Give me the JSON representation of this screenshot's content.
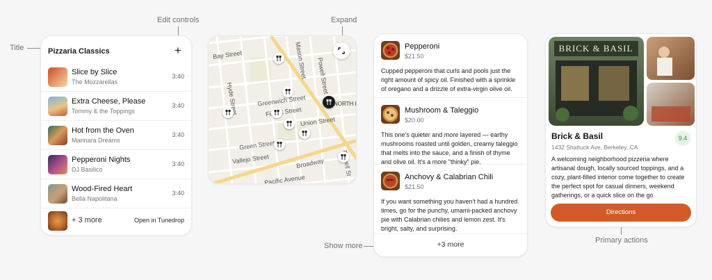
{
  "annotations": {
    "title": "Title",
    "edit_controls": "Edit controls",
    "expand": "Expand",
    "show_more": "Show more",
    "primary_actions": "Primary actions"
  },
  "playlist": {
    "title": "Pizzaria Classics",
    "add_icon": "plus-icon",
    "tracks": [
      {
        "title": "Slice by Slice",
        "artist": "The Mozzarellas",
        "duration": "3:40"
      },
      {
        "title": "Extra Cheese, Please",
        "artist": "Tommy & the Toppings",
        "duration": "3:40"
      },
      {
        "title": "Hot from the Oven",
        "artist": "Marinara Dreams",
        "duration": "3:40"
      },
      {
        "title": "Pepperoni Nights",
        "artist": "DJ Basilico",
        "duration": "3:40"
      },
      {
        "title": "Wood-Fired Heart",
        "artist": "Bella Napolitana",
        "duration": "3:40"
      }
    ],
    "more_label": "+ 3 more",
    "open_label": "Open in Tunedrop"
  },
  "map": {
    "streets": {
      "bay": "Bay Street",
      "mason": "Mason Street",
      "powell_top": "Powell Street",
      "hyde": "Hyde Street",
      "greenwich": "Greenwich Street",
      "filbert": "Filbert Street",
      "union": "Union Street",
      "green": "Green Street",
      "vallejo": "Vallejo Street",
      "broadway": "Broadway",
      "pacific": "Pacific Avenue",
      "powell_bottom": "Powell St",
      "north_beach": "NORTH BE"
    },
    "expand_icon": "expand-icon",
    "pin_icon": "restaurant-icon"
  },
  "menu": {
    "items": [
      {
        "name": "Pepperoni",
        "price": "$21.50",
        "description": "Cupped pepperoni that curls and pools just the right amount of spicy oil. Finished with a sprinkle of oregano and a drizzle of extra-virgin olive oil."
      },
      {
        "name": "Mushroom & Taleggio",
        "price": "$20.00",
        "description": "This one's quieter and more layered — earthy mushrooms roasted until golden, creamy taleggio that melts into the sauce, and a finish of thyme and olive oil. It's a more \"thinky\" pie."
      },
      {
        "name": "Anchovy & Calabrian Chili",
        "price": "$21.50",
        "description": "If you want something you haven't had a hundred times, go for the punchy, umami-packed anchovy pie with Calabrian chilies and lemon zest. It's bright, salty, and surprising."
      }
    ],
    "show_more_label": "+3 more"
  },
  "venue": {
    "sign_text": "BRICK & BASIL",
    "name": "Brick & Basil",
    "address": "1432 Shattuck Ave, Berkeley, CA",
    "rating": "9.4",
    "description": "A welcoming neighborhood pizzeria where artisanal dough, locally sourced toppings, and a cozy, plant-filled interior come together to create the perfect spot for casual dinners, weekend gatherings, or a quick slice on the go",
    "button_label": "Directions",
    "accent_color": "#d35a28"
  }
}
